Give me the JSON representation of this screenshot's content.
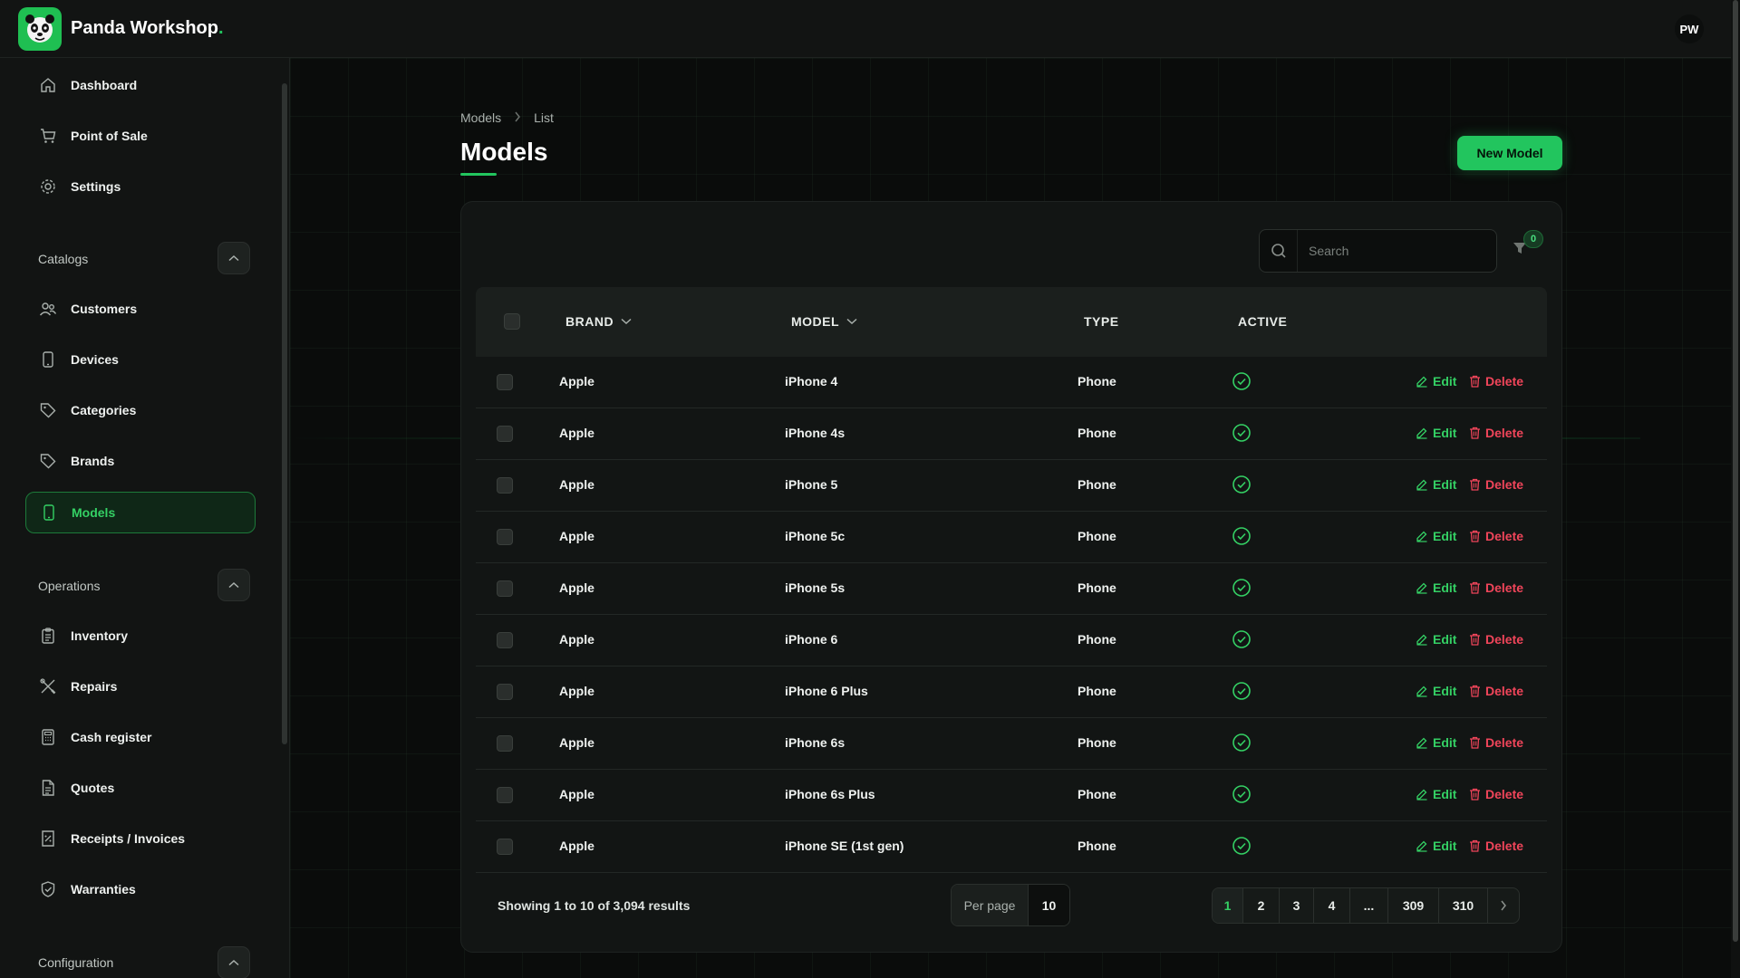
{
  "app": {
    "name": "Panda Workshop",
    "name_dot": ".",
    "user_initials": "PW"
  },
  "sidebar": {
    "top_items": [
      {
        "label": "Dashboard",
        "icon": "home-icon"
      },
      {
        "label": "Point of Sale",
        "icon": "cart-icon"
      },
      {
        "label": "Settings",
        "icon": "gear-icon"
      }
    ],
    "groups": [
      {
        "label": "Catalogs",
        "items": [
          {
            "label": "Customers",
            "icon": "users-icon"
          },
          {
            "label": "Devices",
            "icon": "phone-icon"
          },
          {
            "label": "Categories",
            "icon": "tag-icon"
          },
          {
            "label": "Brands",
            "icon": "tag-icon"
          },
          {
            "label": "Models",
            "icon": "phone-icon",
            "active": true
          }
        ]
      },
      {
        "label": "Operations",
        "items": [
          {
            "label": "Inventory",
            "icon": "clipboard-icon"
          },
          {
            "label": "Repairs",
            "icon": "tools-icon"
          },
          {
            "label": "Cash register",
            "icon": "register-icon"
          },
          {
            "label": "Quotes",
            "icon": "document-icon"
          },
          {
            "label": "Receipts / Invoices",
            "icon": "receipt-icon"
          },
          {
            "label": "Warranties",
            "icon": "shield-icon"
          }
        ]
      },
      {
        "label": "Configuration",
        "items": []
      }
    ]
  },
  "breadcrumb": [
    "Models",
    "List"
  ],
  "page": {
    "title": "Models",
    "new_button": "New Model"
  },
  "search": {
    "placeholder": "Search"
  },
  "filter": {
    "count": "0"
  },
  "table": {
    "columns": [
      "BRAND",
      "MODEL",
      "TYPE",
      "ACTIVE"
    ],
    "rows": [
      {
        "brand": "Apple",
        "model": "iPhone 4",
        "type": "Phone",
        "active": true
      },
      {
        "brand": "Apple",
        "model": "iPhone 4s",
        "type": "Phone",
        "active": true
      },
      {
        "brand": "Apple",
        "model": "iPhone 5",
        "type": "Phone",
        "active": true
      },
      {
        "brand": "Apple",
        "model": "iPhone 5c",
        "type": "Phone",
        "active": true
      },
      {
        "brand": "Apple",
        "model": "iPhone 5s",
        "type": "Phone",
        "active": true
      },
      {
        "brand": "Apple",
        "model": "iPhone 6",
        "type": "Phone",
        "active": true
      },
      {
        "brand": "Apple",
        "model": "iPhone 6 Plus",
        "type": "Phone",
        "active": true
      },
      {
        "brand": "Apple",
        "model": "iPhone 6s",
        "type": "Phone",
        "active": true
      },
      {
        "brand": "Apple",
        "model": "iPhone 6s Plus",
        "type": "Phone",
        "active": true
      },
      {
        "brand": "Apple",
        "model": "iPhone SE (1st gen)",
        "type": "Phone",
        "active": true
      }
    ],
    "actions": {
      "edit": "Edit",
      "delete": "Delete"
    }
  },
  "footer": {
    "results_text": "Showing 1 to 10 of 3,094 results",
    "per_page_label": "Per page",
    "per_page_value": "10",
    "pages": [
      "1",
      "2",
      "3",
      "4",
      "...",
      "309",
      "310"
    ],
    "current_page": "1"
  },
  "colors": {
    "accent": "#22c55e",
    "danger": "#f0455a",
    "background": "#0a0c0b",
    "surface": "#121413"
  }
}
